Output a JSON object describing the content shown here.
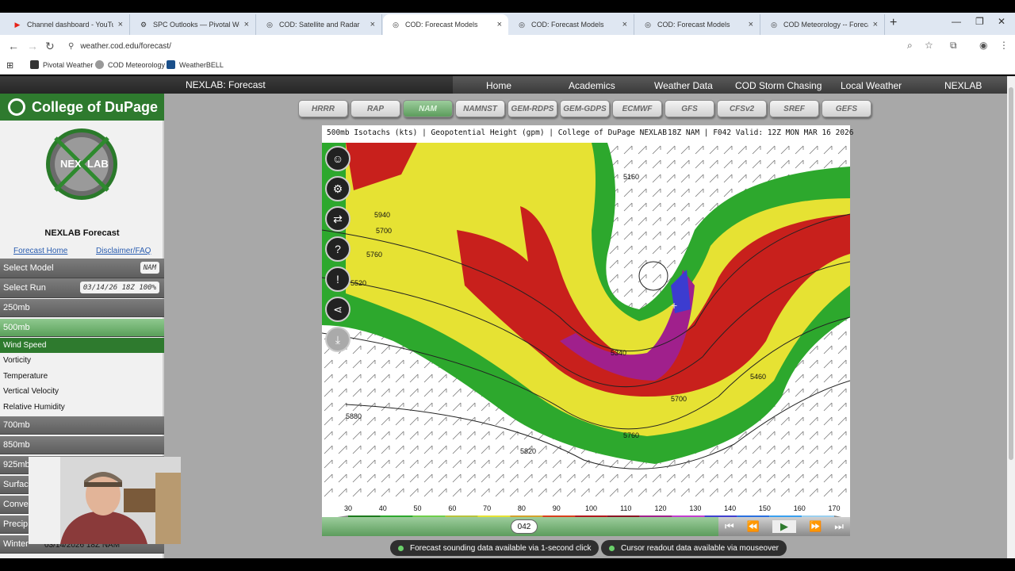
{
  "browser": {
    "tabs": [
      {
        "label": "Channel dashboard - YouTube",
        "icon": "youtube-icon",
        "color": "#e62117"
      },
      {
        "label": "SPC Outlooks — Pivotal Weather",
        "icon": "gear-icon",
        "color": "#222222"
      },
      {
        "label": "COD: Satellite and Radar",
        "icon": "cod-icon",
        "color": "#777777"
      },
      {
        "label": "COD: Forecast Models",
        "icon": "cod-icon",
        "color": "#777777"
      },
      {
        "label": "COD: Forecast Models",
        "icon": "cod-icon",
        "color": "#777777"
      },
      {
        "label": "COD: Forecast Models",
        "icon": "cod-icon",
        "color": "#777777"
      },
      {
        "label": "COD Meteorology -- Forecast S",
        "icon": "cod-icon",
        "color": "#777777"
      }
    ],
    "url": "weather.cod.edu/forecast/",
    "bookmarks": [
      "Pivotal Weather",
      "COD Meteorology",
      "WeatherBELL"
    ]
  },
  "site": {
    "title": "NEXLAB: Forecast",
    "menu": [
      "Home",
      "Academics",
      "Weather Data",
      "COD Storm Chasing",
      "Local Weather",
      "NEXLAB"
    ]
  },
  "sidebar": {
    "brand": "College of DuPage",
    "logo_left": "NEX",
    "logo_right": "LAB",
    "heading": "NEXLAB Forecast",
    "links": [
      "Forecast Home",
      "Disclaimer/FAQ"
    ],
    "select_model_label": "Select Model",
    "select_model_value": "NAM",
    "select_run_label": "Select Run",
    "select_run_value": "03/14/26 18Z 100%",
    "levels_top": [
      "250mb",
      "500mb"
    ],
    "subitems": [
      "Wind Speed",
      "Vorticity",
      "Temperature",
      "Vertical Velocity",
      "Relative Humidity"
    ],
    "levels_bottom": [
      "700mb",
      "850mb",
      "925mb",
      "Surface",
      "Convection",
      "Precip",
      "Winter"
    ],
    "run_caption": "03/14/2026 18Z NAM"
  },
  "models": [
    "HRRR",
    "RAP",
    "NAM",
    "NAMNST",
    "GEM-RDPS",
    "GEM-GDPS",
    "ECMWF",
    "GFS",
    "CFSv2",
    "SREF",
    "GEFS"
  ],
  "active_model": "NAM",
  "map": {
    "title": "500mb Isotachs (kts) | Geopotential Height (gpm) | College of DuPage NEXLAB",
    "valid": "18Z NAM | F042 Valid: 12Z MON MAR 16 2026",
    "contour_labels": [
      "5160",
      "5940",
      "5700",
      "5760",
      "5520",
      "5880",
      "5820",
      "5760",
      "5700",
      "5340",
      "5460"
    ]
  },
  "scale": {
    "ticks": [
      "30",
      "40",
      "50",
      "60",
      "70",
      "80",
      "90",
      "100",
      "110",
      "120",
      "130",
      "140",
      "150",
      "160",
      "170"
    ],
    "colors": [
      "#1c7a1c",
      "#2da82d",
      "#6fcf4a",
      "#b8c33a",
      "#e6e233",
      "#d4a22a",
      "#d8401c",
      "#b0181c",
      "#8a1424",
      "#a0208c",
      "#c23ed0",
      "#4040d0",
      "#2a70e0",
      "#3aa0f0",
      "#9ad0f0"
    ]
  },
  "timeline": {
    "frame": "042",
    "controls": [
      "first-frame-icon",
      "rewind-icon",
      "play-icon",
      "fast-forward-icon",
      "last-frame-icon"
    ]
  },
  "info": {
    "sounding": "Forecast sounding data available via 1-second click",
    "cursor": "Cursor readout data available via mouseover"
  }
}
